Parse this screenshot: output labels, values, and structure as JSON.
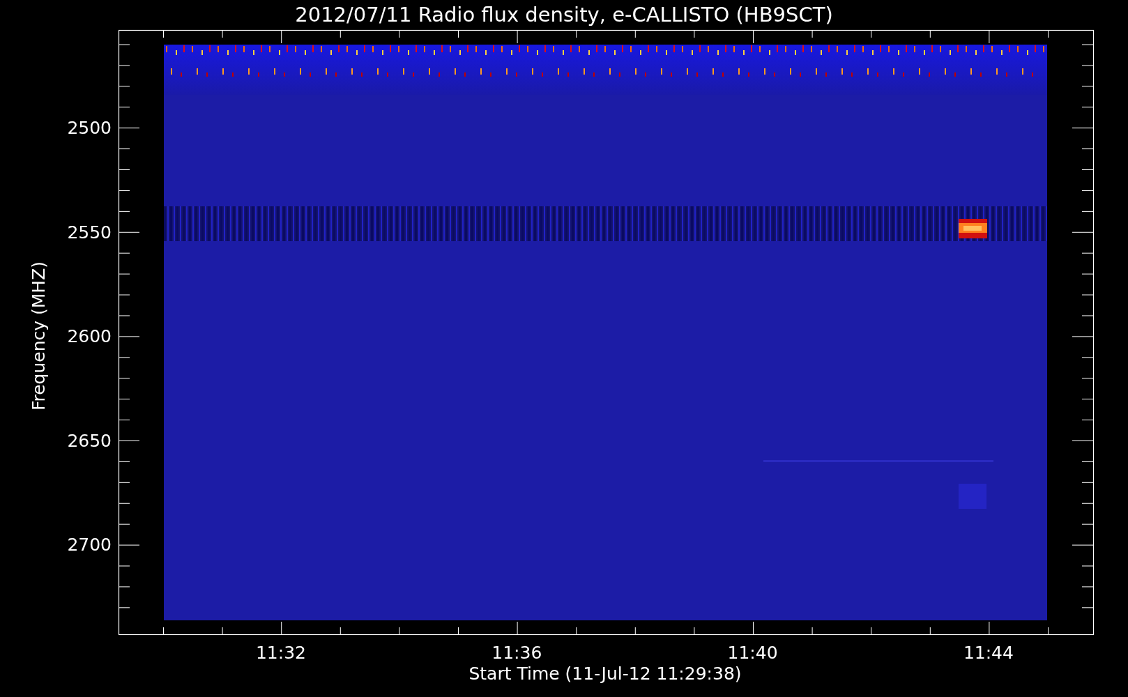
{
  "title": "2012/07/11  Radio flux density, e-CALLISTO (HB9SCT)",
  "xlabel": "Start Time (11-Jul-12 11:29:38)",
  "ylabel": "Frequency (MHZ)",
  "yticks": [
    "2500",
    "2550",
    "2600",
    "2650",
    "2700"
  ],
  "xticks": [
    "11:32",
    "11:36",
    "11:40",
    "11:44"
  ]
}
